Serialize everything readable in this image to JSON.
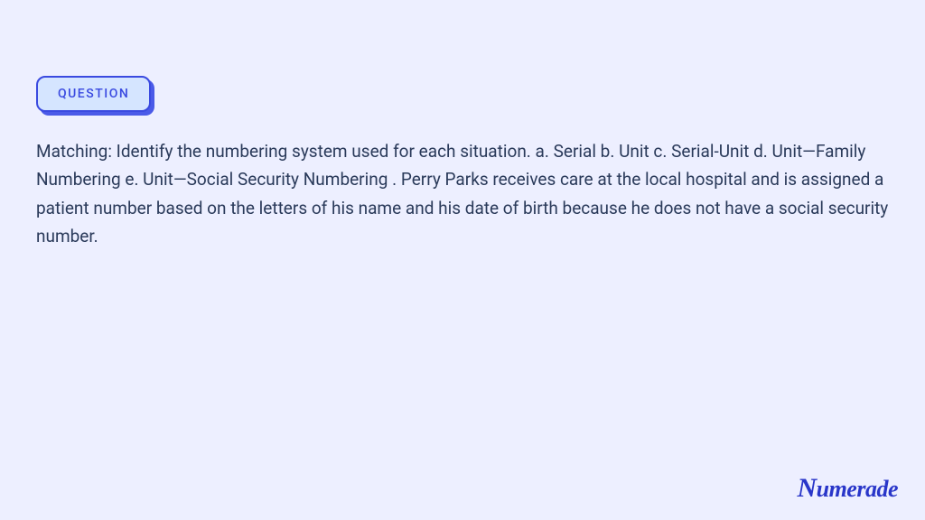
{
  "badge": {
    "label": "QUESTION"
  },
  "question": {
    "text": "Matching: Identify the numbering system used for each situation. a. Serial b. Unit c. Serial-Unit d. Unit—Family Numbering e. Unit—Social Security Numbering . Perry Parks receives care at the local hospital and is assigned a patient number based on the letters of his name and his date of birth because he does not have a social security number."
  },
  "branding": {
    "name": "Numerade"
  }
}
